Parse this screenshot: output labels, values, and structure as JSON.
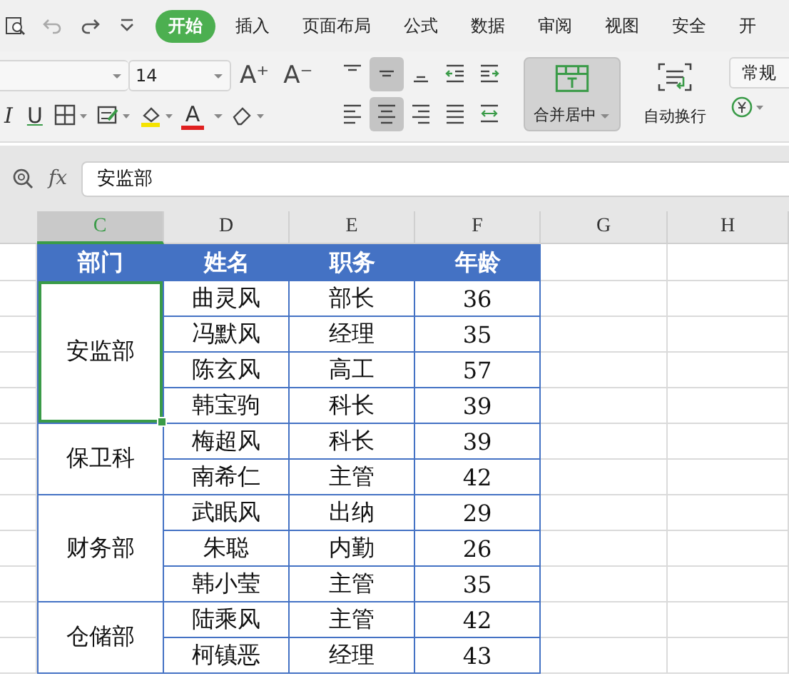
{
  "menu_tabs": [
    {
      "label": "开始",
      "selected": true
    },
    {
      "label": "插入",
      "selected": false
    },
    {
      "label": "页面布局",
      "selected": false
    },
    {
      "label": "公式",
      "selected": false
    },
    {
      "label": "数据",
      "selected": false
    },
    {
      "label": "审阅",
      "selected": false
    },
    {
      "label": "视图",
      "selected": false
    },
    {
      "label": "安全",
      "selected": false
    },
    {
      "label": "开",
      "selected": false
    }
  ],
  "ribbon": {
    "font_size": "14",
    "grow_font": "A⁺",
    "shrink_font": "A⁻",
    "italic": "I",
    "underline": "U",
    "font_color": "A",
    "alignment": [
      {
        "kind": "top",
        "selected": false
      },
      {
        "kind": "middle",
        "selected": true
      },
      {
        "kind": "bottom",
        "selected": false
      },
      {
        "kind": "outdent",
        "selected": false
      },
      {
        "kind": "indent",
        "selected": false
      },
      {
        "kind": "left",
        "selected": false
      },
      {
        "kind": "center",
        "selected": true
      },
      {
        "kind": "right",
        "selected": false
      },
      {
        "kind": "justify",
        "selected": false
      },
      {
        "kind": "distribute",
        "selected": false
      }
    ],
    "merge": {
      "label": "合并居中",
      "selected": true
    },
    "wrap": {
      "label": "自动换行"
    },
    "number_format": "常规"
  },
  "formula_bar": {
    "fx": "fx",
    "value": "安监部"
  },
  "columns": [
    {
      "label": "C",
      "selected": true
    },
    {
      "label": "D",
      "selected": false
    },
    {
      "label": "E",
      "selected": false
    },
    {
      "label": "F",
      "selected": false
    },
    {
      "label": "G",
      "selected": false
    },
    {
      "label": "H",
      "selected": false
    }
  ],
  "table": {
    "headers": [
      "部门",
      "姓名",
      "职务",
      "年龄"
    ],
    "groups": [
      {
        "department": "安监部",
        "selected": true,
        "rows": [
          {
            "name": "曲灵风",
            "title": "部长",
            "age": "36"
          },
          {
            "name": "冯默风",
            "title": "经理",
            "age": "35"
          },
          {
            "name": "陈玄风",
            "title": "高工",
            "age": "57"
          },
          {
            "name": "韩宝驹",
            "title": "科长",
            "age": "39"
          }
        ]
      },
      {
        "department": "保卫科",
        "selected": false,
        "rows": [
          {
            "name": "梅超风",
            "title": "科长",
            "age": "39"
          },
          {
            "name": "南希仁",
            "title": "主管",
            "age": "42"
          }
        ]
      },
      {
        "department": "财务部",
        "selected": false,
        "rows": [
          {
            "name": "武眠风",
            "title": "出纳",
            "age": "29"
          },
          {
            "name": "朱聪",
            "title": "内勤",
            "age": "26"
          },
          {
            "name": "韩小莹",
            "title": "主管",
            "age": "35"
          }
        ]
      },
      {
        "department": "仓储部",
        "selected": false,
        "rows": [
          {
            "name": "陆乘风",
            "title": "主管",
            "age": "42"
          },
          {
            "name": "柯镇恶",
            "title": "经理",
            "age": "43"
          }
        ]
      }
    ]
  }
}
